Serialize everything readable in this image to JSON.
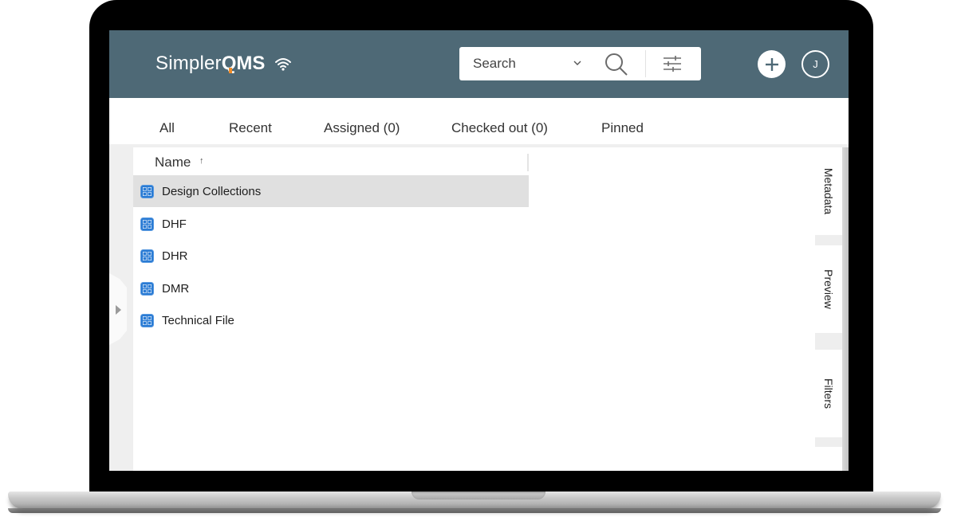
{
  "header": {
    "logo_light": "Simpler",
    "logo_bold": "QMS",
    "logo_icon": "wifi-signal-icon",
    "brand_color": "#4e6976",
    "logo_accent_color": "#f28c28",
    "search": {
      "placeholder": "Search",
      "value": "",
      "dropdown_icon": "chevron-down-icon",
      "search_icon": "magnifier-icon",
      "filter_icon": "sliders-icon"
    },
    "add_icon": "plus-icon",
    "avatar_initial": "J"
  },
  "tabs": [
    {
      "label": "All"
    },
    {
      "label": "Recent"
    },
    {
      "label": "Assigned (0)"
    },
    {
      "label": "Checked out (0)"
    },
    {
      "label": "Pinned"
    }
  ],
  "list": {
    "column_header": "Name",
    "sort_indicator": "↑",
    "sort_direction": "ascending",
    "item_icon": "view-grid-icon",
    "item_icon_color": "#2a7bd4",
    "selected_index": 0,
    "items": [
      {
        "label": "Design Collections"
      },
      {
        "label": "DHF"
      },
      {
        "label": "DHR"
      },
      {
        "label": "DMR"
      },
      {
        "label": "Technical File"
      }
    ]
  },
  "side_panel": {
    "tabs": [
      {
        "label": "Metadata"
      },
      {
        "label": "Preview"
      },
      {
        "label": "Filters"
      }
    ]
  }
}
